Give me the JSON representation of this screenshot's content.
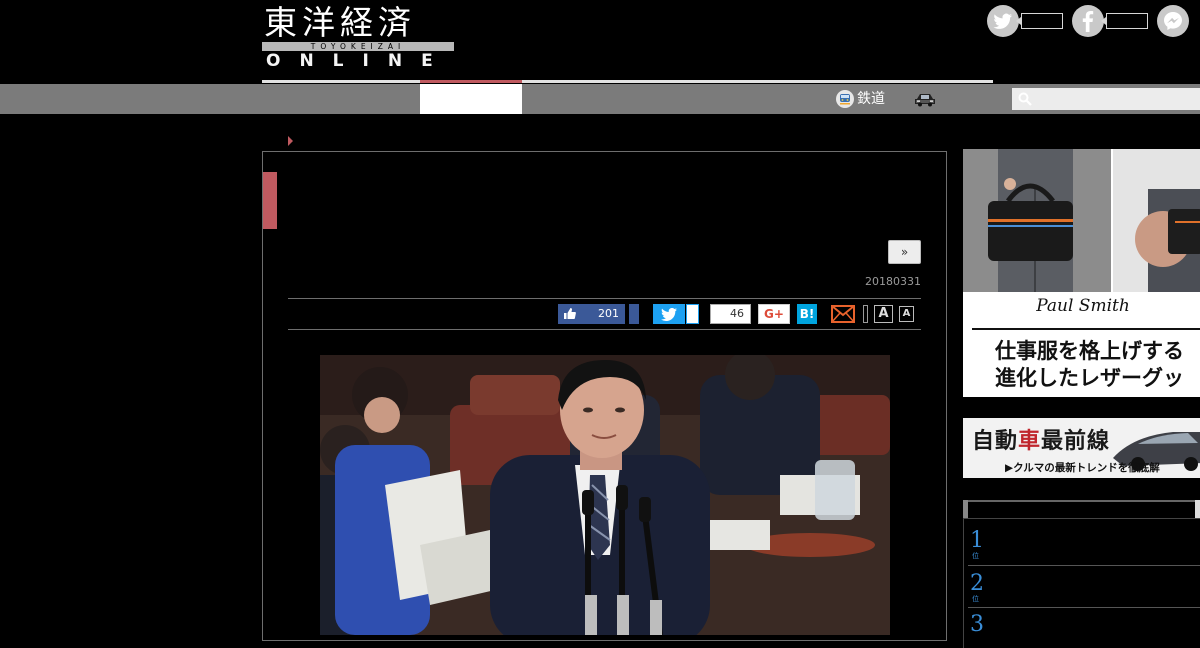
{
  "header": {
    "logo_kanji": "東洋経済",
    "logo_band": "TOYOKEIZAI",
    "logo_online": "ONLINE"
  },
  "social": {
    "icons": [
      "twitter-icon",
      "facebook-icon",
      "messenger-icon"
    ]
  },
  "nav": {
    "railway_label": "鉄道",
    "railway_icon": "train-icon",
    "car_icon": "car-icon",
    "search_icon": "search-icon"
  },
  "article": {
    "date": "20180331",
    "next_label": "»"
  },
  "share": {
    "like_count": "201",
    "pocket_count": "46",
    "gplus_label": "G+",
    "hatena_label": "B!",
    "font_large_label": "A",
    "font_small_label": "A"
  },
  "sidebar": {
    "ad_brand": "Paul Smith",
    "ad_copy_1": "仕事服を格上げする",
    "ad_copy_2": "進化したレザーグッ",
    "banner_title_1": "自動",
    "banner_title_red": "車",
    "banner_title_2": "最前線",
    "banner_sub": "▶クルマの最新トレンドを徹底解",
    "ranks": [
      {
        "num": "1",
        "sub": "位"
      },
      {
        "num": "2",
        "sub": "位"
      },
      {
        "num": "3",
        "sub": ""
      }
    ]
  },
  "colors": {
    "accent": "#c05a60",
    "nav_bar": "#7b7b7b",
    "facebook": "#3b5998",
    "twitter": "#1da1f2",
    "hatena": "#00a4de",
    "rank_number": "#3a8ed8"
  }
}
